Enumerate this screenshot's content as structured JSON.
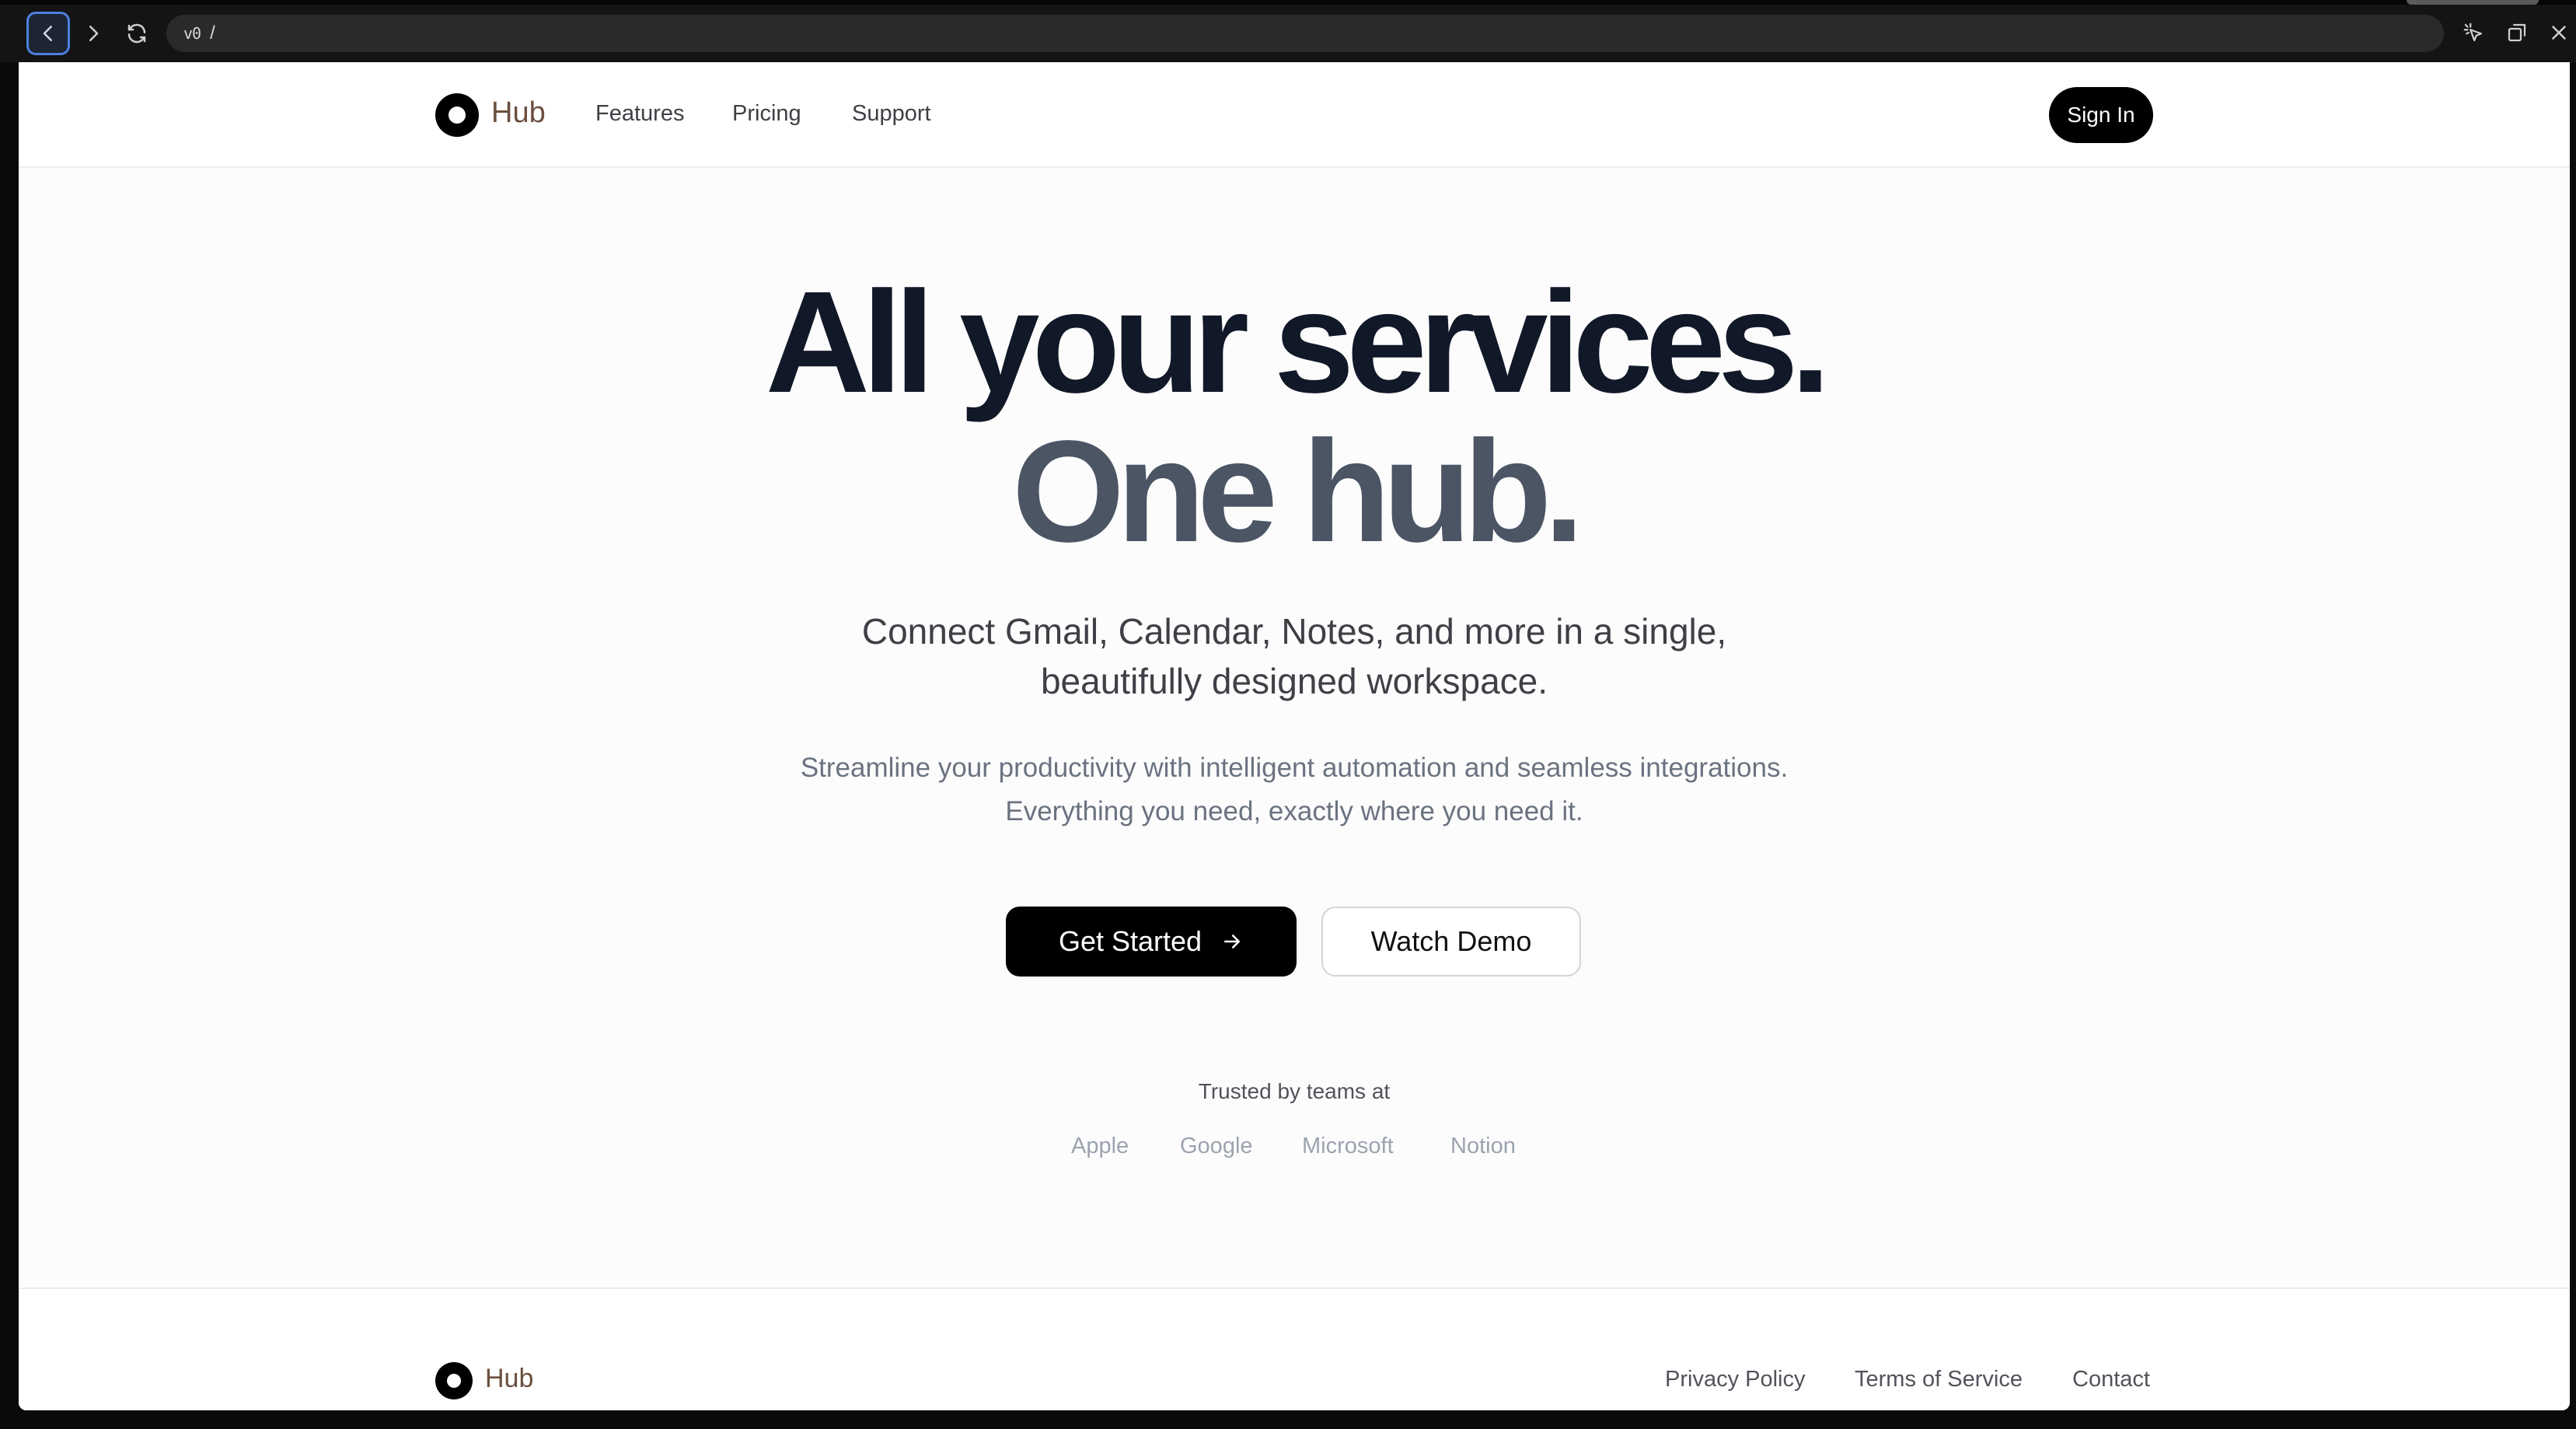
{
  "browser": {
    "address_prefix": "v0",
    "address_path": "/",
    "icons": [
      "back-icon",
      "forward-icon",
      "reload-icon",
      "element-picker-icon",
      "popout-icon",
      "close-icon"
    ]
  },
  "header": {
    "brand": "Hub",
    "nav": [
      "Features",
      "Pricing",
      "Support"
    ],
    "signin_label": "Sign In"
  },
  "hero": {
    "title_line1": "All your services.",
    "title_line2": "One hub.",
    "subtitle_line1": "Connect Gmail, Calendar, Notes, and more in a single,",
    "subtitle_line2": "beautifully designed workspace.",
    "desc_line1": "Streamline your productivity with intelligent automation and seamless integrations.",
    "desc_line2": "Everything you need, exactly where you need it.",
    "primary_cta": "Get Started",
    "secondary_cta": "Watch Demo",
    "trusted_label": "Trusted by teams at",
    "companies": [
      "Apple",
      "Google",
      "Microsoft",
      "Notion"
    ]
  },
  "footer": {
    "brand": "Hub",
    "links": [
      "Privacy Policy",
      "Terms of Service",
      "Contact"
    ]
  },
  "colors": {
    "brand_text": "#6b4f3f",
    "heading_dark": "#111827",
    "heading_gray": "#4b5563",
    "accent_focus": "#4d7fe0"
  }
}
